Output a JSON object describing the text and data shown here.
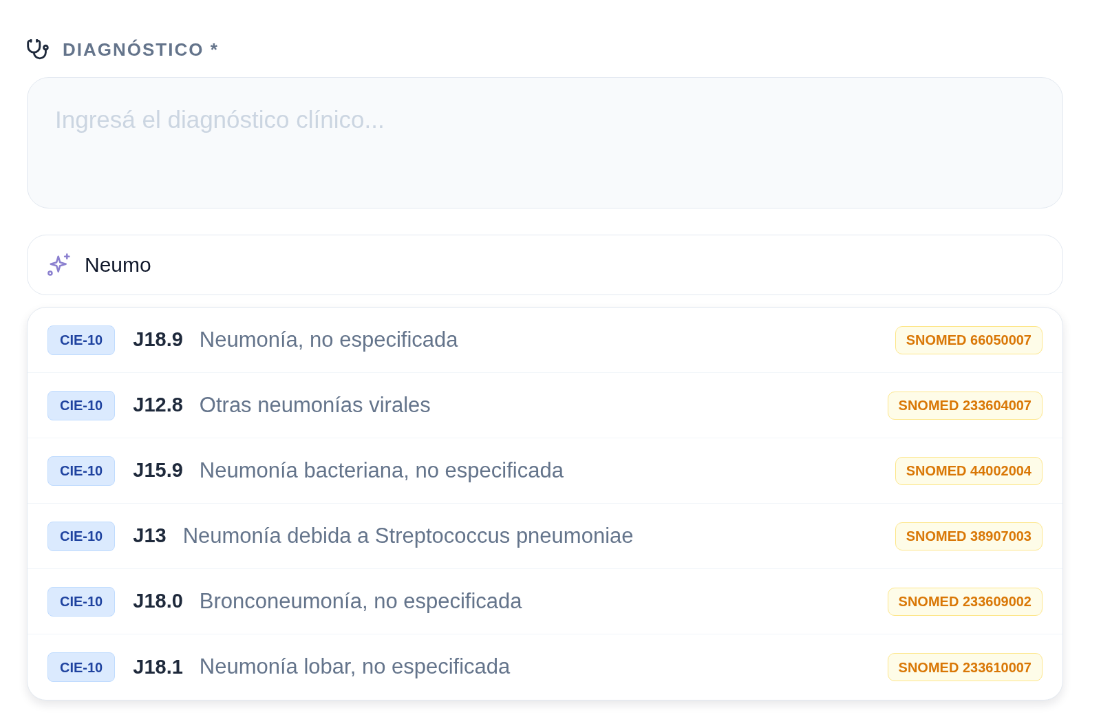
{
  "field": {
    "label": "DIAGNÓSTICO *",
    "placeholder": "Ingresá el diagnóstico clínico..."
  },
  "search": {
    "value": "Neumo"
  },
  "suggestions": [
    {
      "system": "CIE-10",
      "code": "J18.9",
      "description": "Neumonía, no especificada",
      "snomed": "SNOMED 66050007"
    },
    {
      "system": "CIE-10",
      "code": "J12.8",
      "description": "Otras neumonías virales",
      "snomed": "SNOMED 233604007"
    },
    {
      "system": "CIE-10",
      "code": "J15.9",
      "description": "Neumonía bacteriana, no especificada",
      "snomed": "SNOMED 44002004"
    },
    {
      "system": "CIE-10",
      "code": "J13",
      "description": "Neumonía debida a Streptococcus pneumoniae",
      "snomed": "SNOMED 38907003"
    },
    {
      "system": "CIE-10",
      "code": "J18.0",
      "description": "Bronconeumonía, no especificada",
      "snomed": "SNOMED 233609002"
    },
    {
      "system": "CIE-10",
      "code": "J18.1",
      "description": "Neumonía lobar, no especificada",
      "snomed": "SNOMED 233610007"
    }
  ]
}
